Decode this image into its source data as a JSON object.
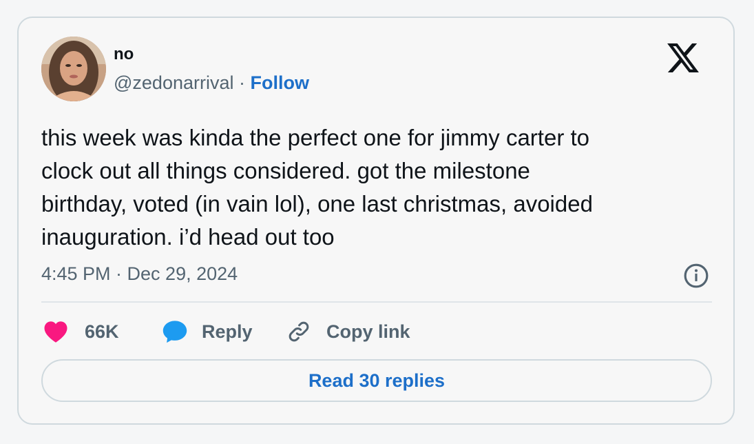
{
  "author": {
    "display_name": "no",
    "handle": "@zedonarrival",
    "separator": " · ",
    "follow_label": "Follow"
  },
  "tweet": {
    "text": "this week was kinda the perfect one for jimmy carter to\nclock out all things considered. got the milestone\nbirthday, voted (in vain lol), one last christmas, avoided\ninauguration. i’d head out too",
    "timestamp": "4:45 PM · Dec 29, 2024"
  },
  "actions": {
    "likes": "66K",
    "reply_label": "Reply",
    "copy_link_label": "Copy link"
  },
  "read_replies_label": "Read 30 replies",
  "icons": {
    "like": "heart-icon",
    "reply": "speech-bubble-icon",
    "copy": "link-icon",
    "info": "info-icon",
    "logo": "x-logo-icon"
  },
  "colors": {
    "link_blue": "#1d6fc9",
    "heart_pink": "#f91880",
    "bubble_blue": "#1d9bf0",
    "muted_text": "#536471"
  }
}
